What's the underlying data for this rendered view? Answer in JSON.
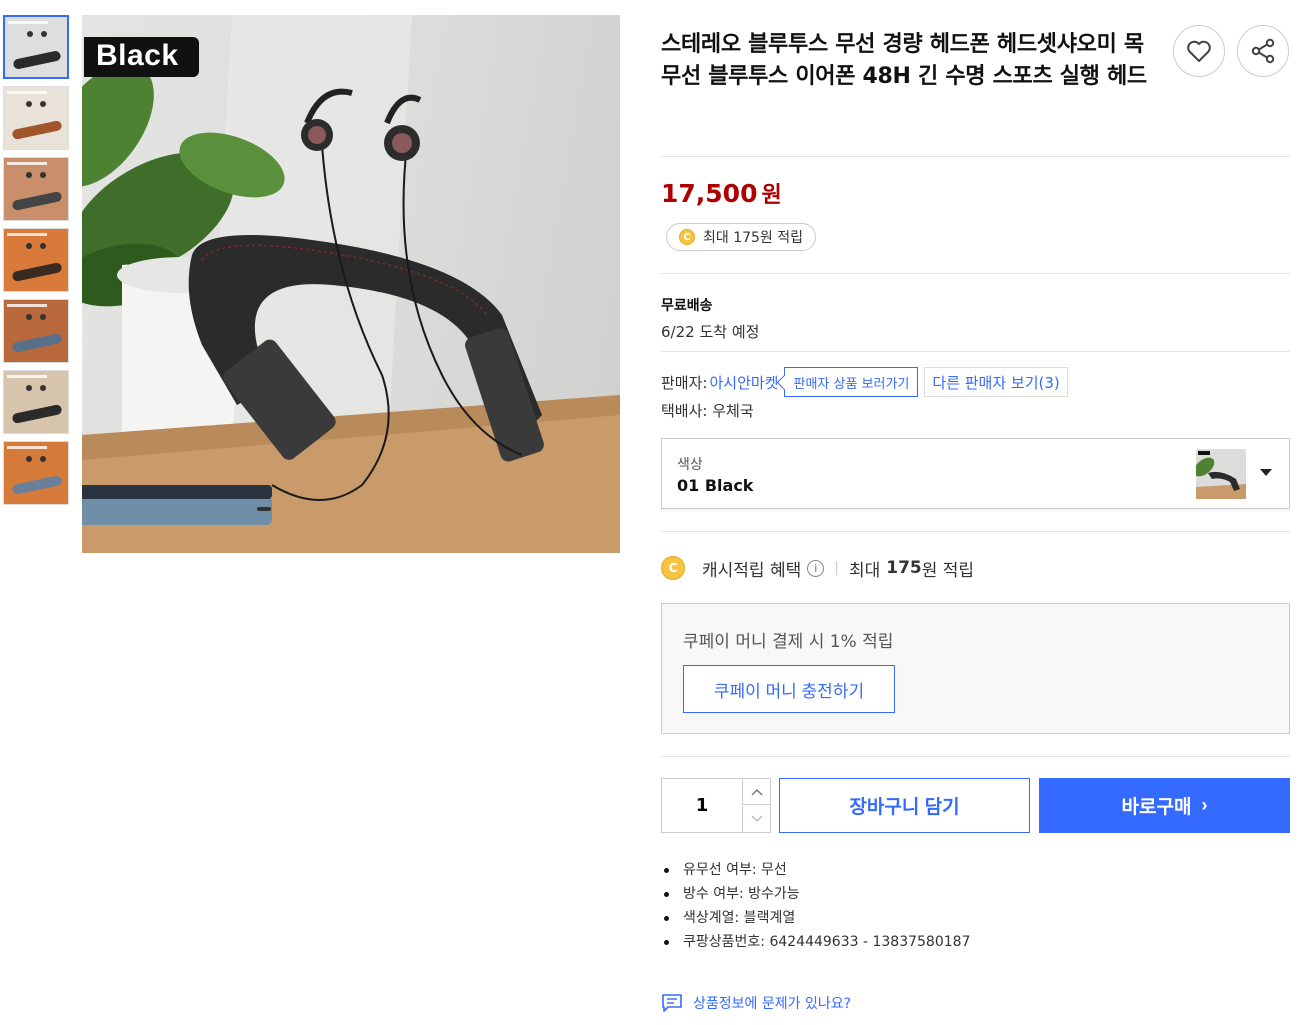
{
  "gallery": {
    "badge_text": "Black",
    "thumbnails": [
      {
        "name": "thumb-1",
        "bg": "#dedede",
        "band": "#2a2a2a",
        "active": true
      },
      {
        "name": "thumb-2",
        "bg": "#e9e2d8",
        "band": "#a0562a",
        "active": false
      },
      {
        "name": "thumb-3",
        "bg": "#c98f6a",
        "band": "#444",
        "active": false
      },
      {
        "name": "thumb-4",
        "bg": "#d97a3a",
        "band": "#3a2a20",
        "active": false
      },
      {
        "name": "thumb-5",
        "bg": "#b8683a",
        "band": "#5a6f8a",
        "active": false
      },
      {
        "name": "thumb-6",
        "bg": "#d6c4ad",
        "band": "#2a2a2a",
        "active": false
      },
      {
        "name": "thumb-7",
        "bg": "#d67a3a",
        "band": "#6a7f9a",
        "active": false
      }
    ]
  },
  "product": {
    "title": "스테레오 블루투스 무선 경량 헤드폰 헤드셋샤오미 목 무선 블루투스 이어폰 48H 긴 수명 스포츠 실행 헤드",
    "price": "17,500",
    "price_unit": "원",
    "reward": "최대 175원 적립"
  },
  "shipping": {
    "label": "무료배송",
    "arrival": "6/22 도착 예정"
  },
  "seller": {
    "label": "판매자:",
    "name": "아시안마켓",
    "view_products": "판매자 상품 보러가기",
    "other_sellers": "다른 판매자 보기(3)",
    "courier": "택배사: 우체국"
  },
  "option": {
    "label": "색상",
    "value": "01 Black"
  },
  "cash": {
    "label": "캐시적립 혜택",
    "amount_prefix": "최대",
    "amount": "175",
    "amount_suffix": "원 적립"
  },
  "coupay": {
    "text": "쿠페이 머니 결제 시 1% 적립",
    "button": "쿠페이 머니 충전하기"
  },
  "purchase": {
    "quantity": "1",
    "cart": "장바구니 담기",
    "buy": "바로구매"
  },
  "attributes": [
    "유무선 여부: 무선",
    "방수 여부: 방수가능",
    "색상계열: 블랙계열",
    "쿠팡상품번호: 6424449633 - 13837580187"
  ],
  "report": "상품정보에 문제가 있나요?",
  "colors": {
    "accent": "#346aff",
    "price": "#ae0000",
    "coin": "#f6c343"
  }
}
